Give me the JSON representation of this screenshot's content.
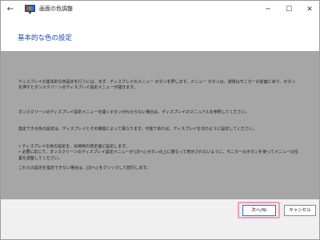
{
  "window": {
    "title": "画面の色調整",
    "back_icon": "←",
    "minimize_icon": "─",
    "maximize_icon": "☐",
    "close_icon": "✕"
  },
  "page": {
    "title": "基本的な色の設定"
  },
  "content": {
    "paragraph1": "ディスプレイの基本的な色設定を行うには、まず、ディスプレイのメニュー ボタンを押します。メニュー ボタンは、通常はモニターの前面にあり、ボタンを押すとオンスクリーンのディスプレイ設定メニューが開きます。",
    "paragraph2": "オンスクリーンのディスプレイ設定メニューを開くボタンがわからない場合は、ディスプレイのマニュアルを参照してください。",
    "paragraph3": "指定できる色の設定は、ディスプレイとその機能によって異なります。可能であれば、ディスプレイを次のように設定してください。",
    "bullets": [
      "• ディスプレイの色の設定を、出荷時の既定値に設定します。",
      "• 必要に応じて、オンスクリーンのディスプレイ設定メニューが [次へ] ボタンの上に重なって表示されないように、モニターのボタンを使ってメニューの位置を調整してください。"
    ],
    "paragraph4": "これらの設定を指定できない場合は、[次へ] をクリックして続行します。"
  },
  "footer": {
    "next_label": "次へ(N)",
    "cancel_label": "キャンセル"
  },
  "colors": {
    "content_bg": "#a6a6a6",
    "title_blue": "#1a4aa6",
    "highlight_pink": "#f29ac2"
  }
}
